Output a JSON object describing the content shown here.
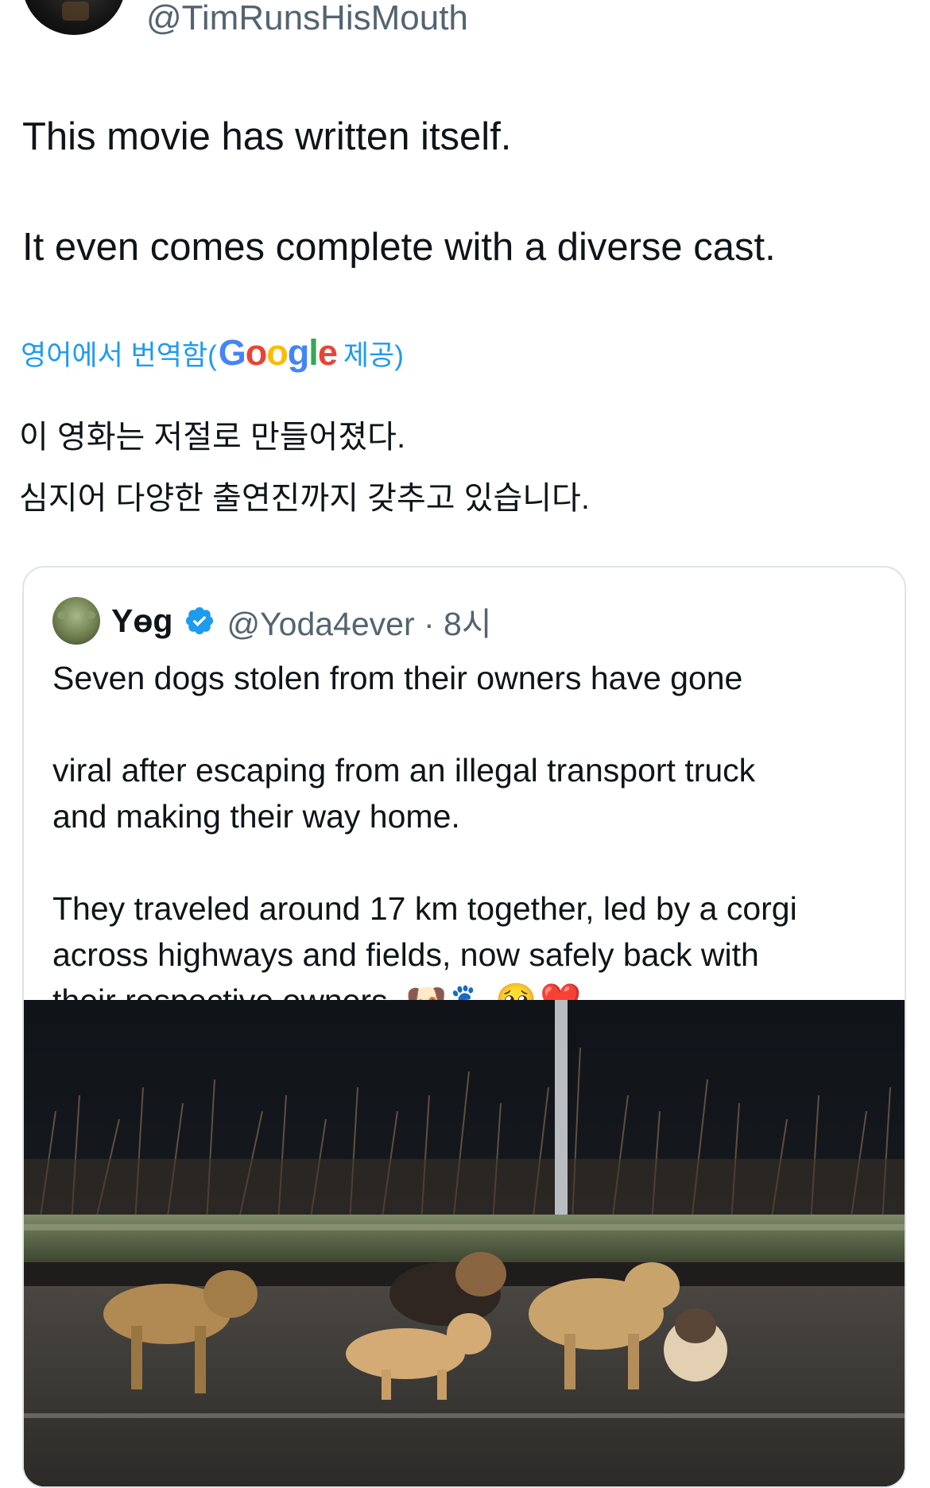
{
  "tweet": {
    "handle": "@TimRunsHisMouth",
    "text_lines": [
      "This movie has written itself.",
      "It even comes complete with a diverse cast."
    ]
  },
  "translation": {
    "prefix": "영어에서 번역함(",
    "google_logo": [
      "G",
      "o",
      "o",
      "g",
      "l",
      "e"
    ],
    "suffix": "제공)",
    "lines": [
      "이 영화는 저절로 만들어졌다.",
      "심지어 다양한 출연진까지 갖추고 있습니다."
    ]
  },
  "quoted_tweet": {
    "name": "Yɵg",
    "verified": true,
    "handle_time": "@Yoda4ever · 8시",
    "lines_1": [
      "Seven dogs stolen from their owners have gone",
      "viral after escaping from an illegal transport truck",
      "and making their way home."
    ],
    "lines_2": [
      "They traveled around 17 km together, led by a corgi",
      "across highways and fields, now safely back with",
      "their respective owners.."
    ],
    "emojis": "🐶🐾🥺❤️"
  },
  "colors": {
    "link": "#1d9bf0",
    "secondary": "#536471",
    "text": "#0f1419",
    "border": "#dfe3e6"
  },
  "icons": [
    "verified-badge-icon"
  ]
}
